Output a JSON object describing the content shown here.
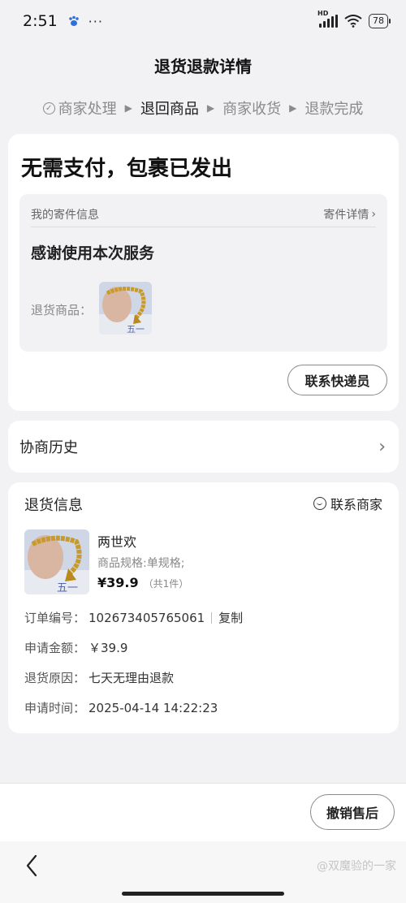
{
  "status_bar": {
    "time": "2:51",
    "dots": "···",
    "network": "HD",
    "battery": "78"
  },
  "header": {
    "title": "退货退款详情"
  },
  "steps": [
    {
      "label": "商家处理",
      "icon": "check-circle-icon"
    },
    {
      "label": "退回商品"
    },
    {
      "label": "商家收货"
    },
    {
      "label": "退款完成"
    }
  ],
  "status_card": {
    "title": "无需支付，包裹已发出",
    "shipping": {
      "heading": "我的寄件信息",
      "detail_link": "寄件详情",
      "message": "感谢使用本次服务",
      "return_goods_label": "退货商品："
    },
    "contact_courier_button": "联系快递员"
  },
  "history": {
    "label": "协商历史"
  },
  "return_info": {
    "title": "退货信息",
    "contact_merchant": "联系商家",
    "product": {
      "name": "两世欢",
      "spec": "商品规格:单规格;",
      "price": "¥39.9",
      "count": "（共1件）"
    },
    "rows": [
      {
        "key": "订单编号：",
        "value": "102673405765061"
      },
      {
        "key": "申请金额：",
        "value": "￥39.9"
      },
      {
        "key": "退货原因：",
        "value": "七天无理由退款"
      },
      {
        "key": "申请时间：",
        "value": "2025-04-14 14:22:23"
      }
    ],
    "copy_label": "复制"
  },
  "bottom": {
    "cancel_button": "撤销售后"
  },
  "watermark": "@双魔验的一家",
  "colors": {
    "background": "#f2f2f4",
    "card": "#ffffff",
    "text": "#1a1a1a",
    "muted": "#8a8a8a"
  }
}
